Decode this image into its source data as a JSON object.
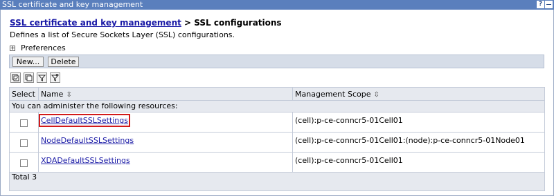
{
  "window": {
    "title": "SSL certificate and key management",
    "help": "?"
  },
  "breadcrumb": {
    "link": "SSL certificate and key management",
    "separator": " > ",
    "current": "SSL configurations"
  },
  "description": "Defines a list of Secure Sockets Layer (SSL) configurations.",
  "preferences": {
    "label": "Preferences",
    "expander": "+"
  },
  "toolbar": {
    "new_label": "New...",
    "delete_label": "Delete"
  },
  "icons": [
    "select-all-icon",
    "deselect-all-icon",
    "show-filter-icon",
    "clear-filter-icon"
  ],
  "table": {
    "columns": {
      "select": "Select",
      "name": "Name",
      "scope": "Management Scope"
    },
    "sort_glyph": "⇳",
    "subheader": "You can administer the following resources:",
    "rows": [
      {
        "name": "CellDefaultSSLSettings",
        "scope": "(cell):p-ce-conncr5-01Cell01",
        "checked": false
      },
      {
        "name": "NodeDefaultSSLSettings",
        "scope": "(cell):p-ce-conncr5-01Cell01:(node):p-ce-conncr5-01Node01",
        "checked": false
      },
      {
        "name": "XDADefaultSSLSettings",
        "scope": "(cell):p-ce-conncr5-01Cell01",
        "checked": false
      }
    ],
    "total": "Total 3"
  }
}
